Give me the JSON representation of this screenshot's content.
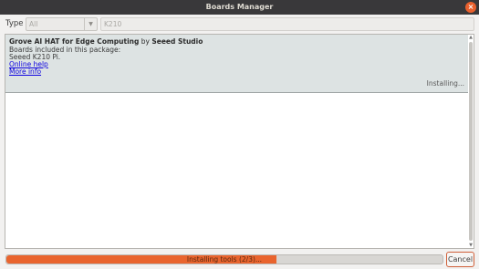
{
  "window": {
    "title": "Boards Manager",
    "close_glyph": "×"
  },
  "filter": {
    "type_label": "Type",
    "type_value": "All",
    "search_value": "K210"
  },
  "board": {
    "name": "Grove AI HAT for Edge Computing",
    "by": "by",
    "vendor": "Seeed Studio",
    "included_label": "Boards included in this package:",
    "boards": "Seeed K210 Pi.",
    "online_help": "Online help",
    "more_info": "More info",
    "status": "Installing..."
  },
  "progress": {
    "text": "Installing tools (2/3)...",
    "fraction": 0.62,
    "color": "#e9642e"
  },
  "buttons": {
    "cancel": "Cancel"
  },
  "icons": {
    "close": "close-icon",
    "dropdown": "chevron-down-icon"
  }
}
